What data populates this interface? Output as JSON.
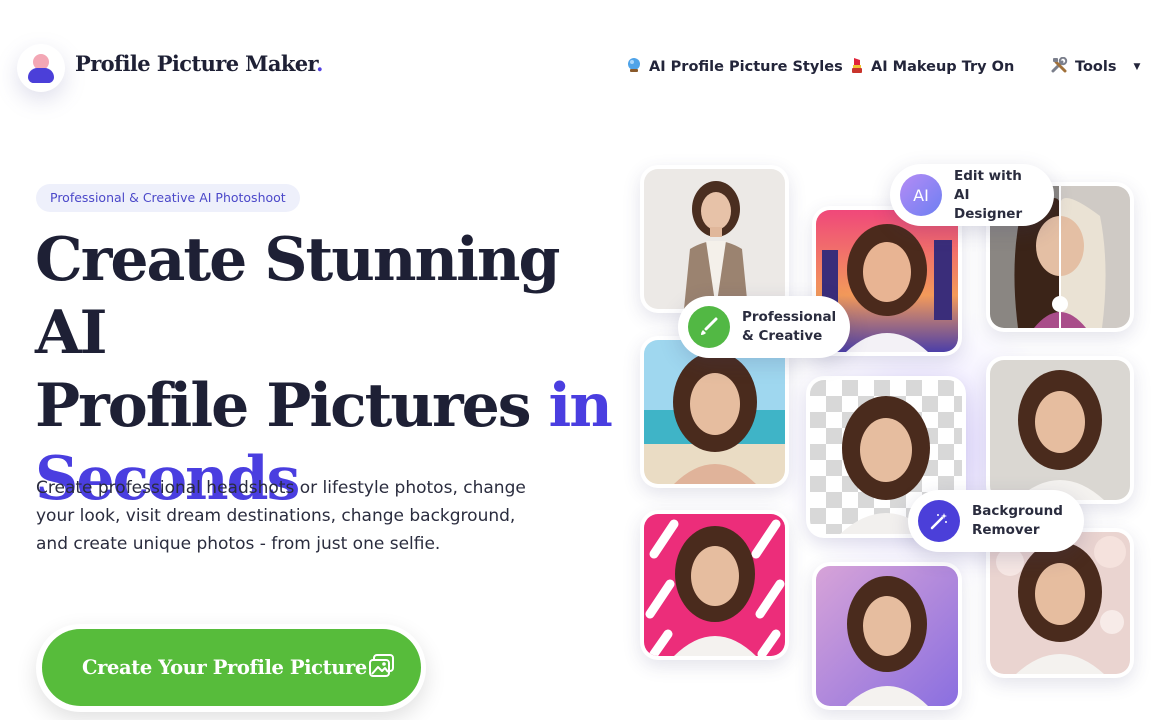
{
  "header": {
    "brand_name": "Profile Picture Maker",
    "brand_dot": ".",
    "nav": [
      {
        "label": "AI Profile Picture Styles",
        "icon": "crystal-ball-icon"
      },
      {
        "label": "AI Makeup Try On",
        "icon": "lipstick-icon"
      },
      {
        "label": "Tools",
        "icon": "tools-icon",
        "dropdown": true
      }
    ]
  },
  "hero": {
    "badge": "Professional & Creative AI Photoshoot",
    "headline_line1": "Create Stunning AI",
    "headline_line2": "Profile Pictures",
    "headline_accent_1": "in",
    "headline_accent_2": "Seconds",
    "subtitle": "Create professional headshots or lifestyle photos, change your look, visit dream destinations, change background, and create unique photos - from just one selfie.",
    "cta_label": "Create Your Profile Picture",
    "cta_icon": "image-gallery-icon"
  },
  "features": [
    {
      "label": "Edit with AI Designer",
      "icon_text": "AI"
    },
    {
      "label": "Professional & Creative",
      "icon": "brush-icon"
    },
    {
      "label": "Background Remover",
      "icon": "magic-wand-icon"
    }
  ],
  "colors": {
    "accent": "#4a3ee0",
    "cta_green": "#57bc3b",
    "text_dark": "#1e2035",
    "badge_bg": "#eef0fb"
  }
}
